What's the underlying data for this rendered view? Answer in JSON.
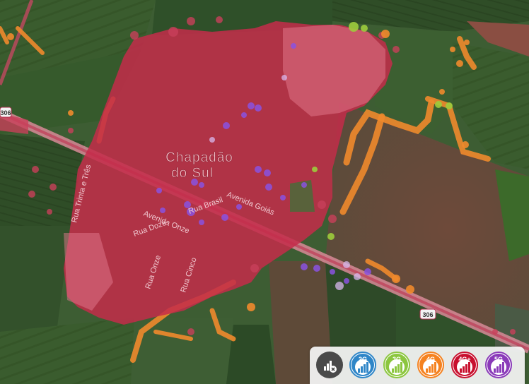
{
  "map": {
    "city_label_line1": "Chapadão",
    "city_label_line2": "do Sul",
    "highway_shield": "306",
    "streets": {
      "rua_brasil": "Rua Brasil",
      "avenida_goias": "Avenida Goiás",
      "avenida_onze": "Avenida Onze",
      "rua_doze": "Rua Doze",
      "rua_onze": "Rua Onze",
      "rua_cinco": "Rua Cinco",
      "rua_trinta_e_tres": "Rua Trinta e Três"
    }
  },
  "legend": {
    "toggle_icon": "signal-off-icon",
    "items": [
      {
        "label": "2G",
        "color": "#2f86c8"
      },
      {
        "label": "3G",
        "color": "#8cc63f"
      },
      {
        "label": "4G",
        "color": "#f58220"
      },
      {
        "label": "4G+",
        "color": "#c8102e"
      },
      {
        "label": "5G",
        "color": "#8a3ab9"
      }
    ]
  }
}
